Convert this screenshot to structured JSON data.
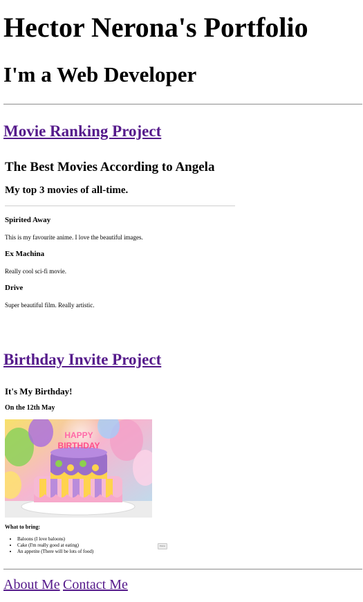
{
  "header": {
    "title": "Hector Nerona's Portfolio",
    "subtitle": "I'm a Web Developer"
  },
  "projects": [
    {
      "link_label": "Movie Ranking Project",
      "preview": {
        "title": "The Best Movies According to Angela",
        "subtitle": "My top 3 movies of all-time.",
        "movies": [
          {
            "name": "Spirited Away",
            "description": "This is my favourite anime. I love the beautiful images."
          },
          {
            "name": "Ex Machina",
            "description": "Really cool sci-fi movie."
          },
          {
            "name": "Drive",
            "description": "Super beautiful film. Really artistic."
          }
        ]
      }
    },
    {
      "link_label": "Birthday Invite Project",
      "preview": {
        "title": "It's My Birthday!",
        "date": "On the 12th May",
        "image_text": "HAPPY BIRTHDAY",
        "bring_heading": "What to bring:",
        "bring_items": [
          "Baloons (I love baloons)",
          "Cake (I'm really good at eating)",
          "An appetite (There will be lots of food)"
        ],
        "tiny_button_label": "Extras"
      }
    }
  ],
  "footer": {
    "about_label": "About Me",
    "contact_label": "Contact Me"
  },
  "colors": {
    "visited_link": "#551a8b",
    "rule": "#8c8c8c"
  }
}
